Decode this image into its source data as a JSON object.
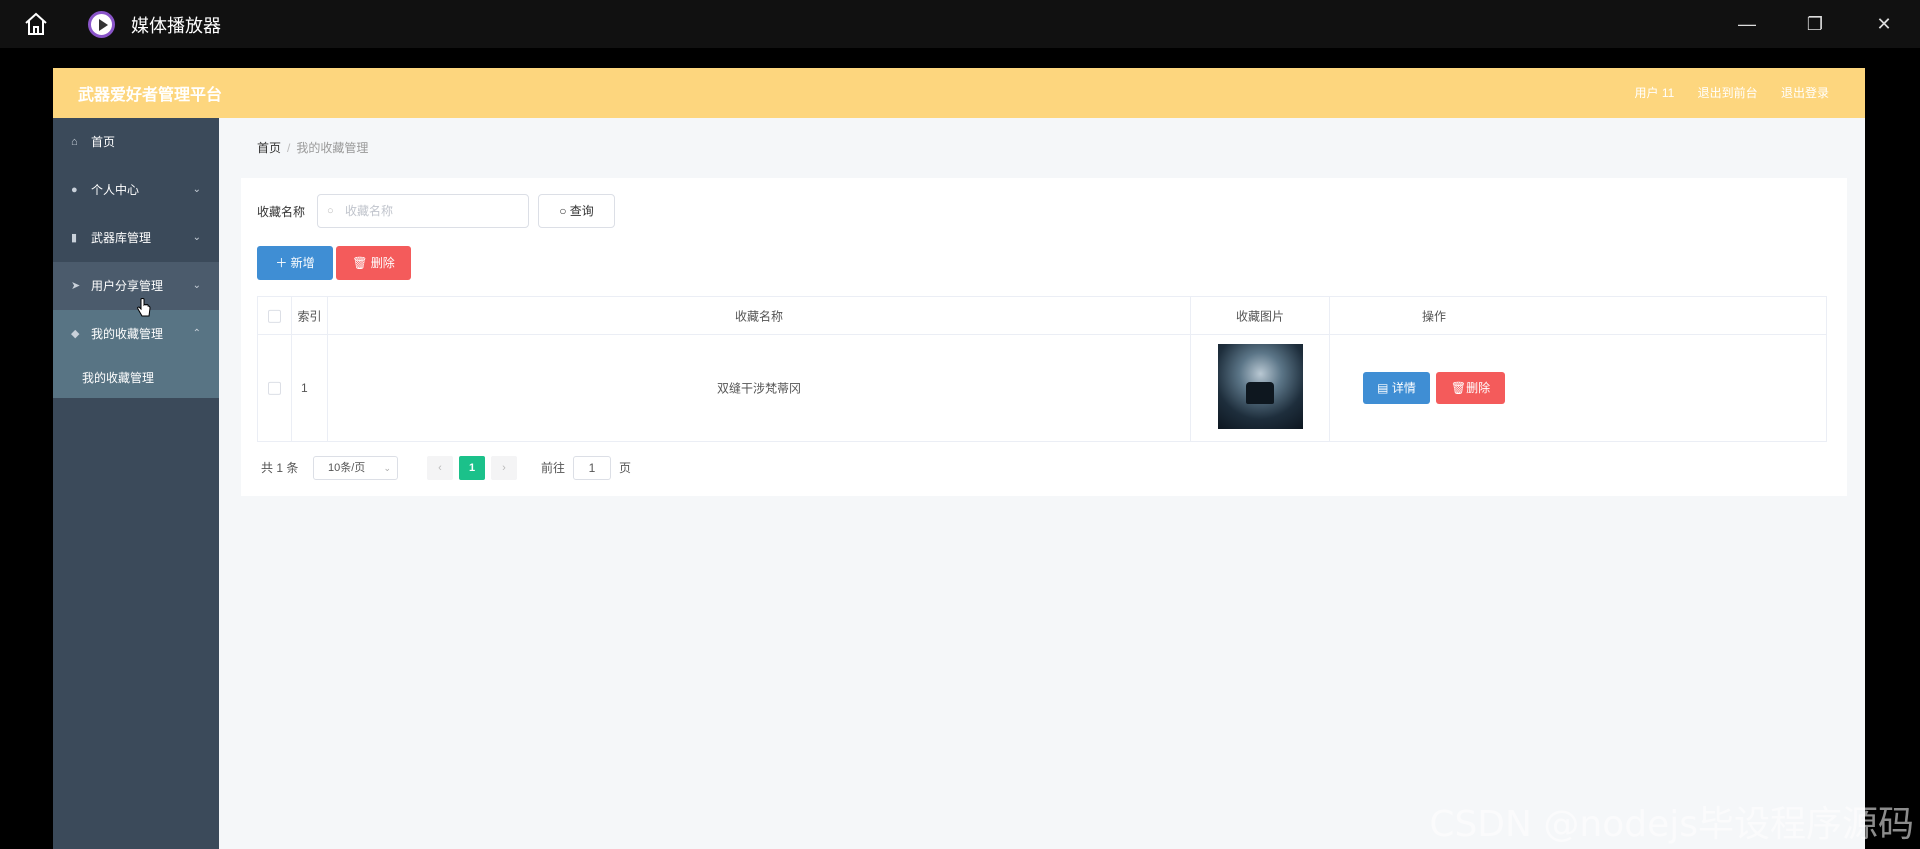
{
  "window": {
    "title": "媒体播放器",
    "minimize": "—",
    "restore": "❐",
    "close": "✕"
  },
  "header": {
    "brand": "武器爱好者管理平台",
    "user": "用户 11",
    "to_front": "退出到前台",
    "logout": "退出登录",
    "color": "#fdd67e"
  },
  "sidebar": {
    "items": [
      {
        "label": "首页",
        "icon": "home-icon"
      },
      {
        "label": "个人中心",
        "icon": "user-icon"
      },
      {
        "label": "武器库管理",
        "icon": "bar-chart-icon"
      },
      {
        "label": "用户分享管理",
        "icon": "send-icon"
      },
      {
        "label": "我的收藏管理",
        "icon": "shield-icon"
      }
    ],
    "submenu": {
      "label": "我的收藏管理"
    }
  },
  "breadcrumb": {
    "home": "首页",
    "sep": "/",
    "current": "我的收藏管理"
  },
  "search": {
    "label": "收藏名称",
    "placeholder": "收藏名称",
    "button": "查询"
  },
  "actions": {
    "add": "新增",
    "delete": "删除"
  },
  "table": {
    "columns": [
      "索引",
      "收藏名称",
      "收藏图片",
      "操作"
    ],
    "rows": [
      {
        "index": "1",
        "name": "双缝干涉梵蒂冈",
        "detail": "详情",
        "delete": "删除"
      }
    ]
  },
  "pagination": {
    "total": "共 1 条",
    "page_size": "10条/页",
    "current_page": "1",
    "goto_label": "前往",
    "goto_value": "1",
    "page_suffix": "页"
  },
  "watermark": "CSDN @nodejs毕设程序源码"
}
